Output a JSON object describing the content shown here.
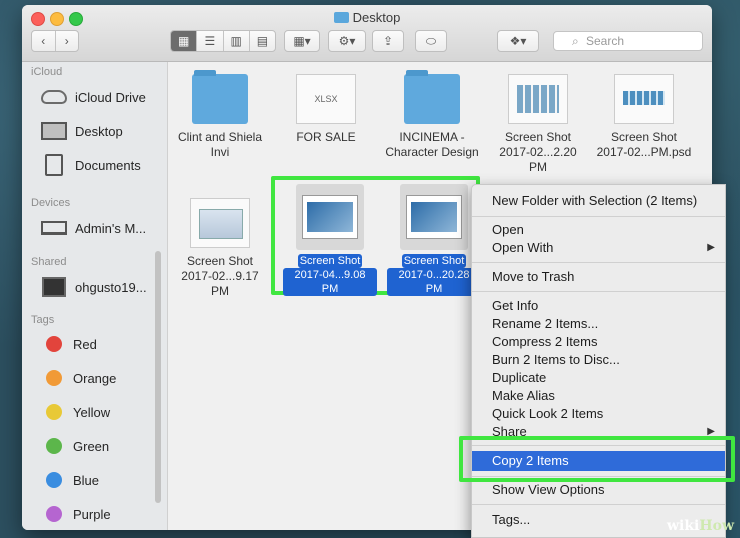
{
  "window": {
    "title": "Desktop"
  },
  "toolbar": {
    "back_icon": "chevron-left-icon",
    "forward_icon": "chevron-right-icon",
    "view_icons": [
      "icon-view-icon",
      "list-view-icon",
      "column-view-icon",
      "gallery-view-icon"
    ],
    "group_icon": "grid-icon",
    "action_icon": "gear-icon",
    "share_icon": "share-icon",
    "tag_icon": "tag-icon",
    "dropbox_icon": "dropbox-icon",
    "search_placeholder": "Search"
  },
  "sidebar": {
    "icloud_header": "iCloud",
    "icloud_items": [
      {
        "label": "iCloud Drive",
        "icon": "cloud-icon"
      },
      {
        "label": "Desktop",
        "icon": "desktop-icon"
      },
      {
        "label": "Documents",
        "icon": "document-icon"
      }
    ],
    "devices_header": "Devices",
    "devices": [
      {
        "label": "Admin's M...",
        "icon": "laptop-icon"
      }
    ],
    "shared_header": "Shared",
    "shared": [
      {
        "label": "ohgusto19...",
        "icon": "monitor-icon"
      }
    ],
    "tags_header": "Tags",
    "tags": [
      {
        "label": "Red",
        "color": "#e2443c"
      },
      {
        "label": "Orange",
        "color": "#f19a37"
      },
      {
        "label": "Yellow",
        "color": "#e8c937"
      },
      {
        "label": "Green",
        "color": "#5cb64b"
      },
      {
        "label": "Blue",
        "color": "#3a8de0"
      },
      {
        "label": "Purple",
        "color": "#b565d0"
      }
    ]
  },
  "files": [
    {
      "name_line1": "Clint and Shiela",
      "name_line2": "Invi",
      "kind": "folder"
    },
    {
      "name_line1": "FOR SALE",
      "name_line2": "",
      "kind": "xlsx",
      "badge": "XLSX"
    },
    {
      "name_line1": "INCINEMA -",
      "name_line2": "Character Design",
      "kind": "folder"
    },
    {
      "name_line1": "Screen Shot",
      "name_line2": "2017-02...2.20 PM",
      "kind": "screenshot"
    },
    {
      "name_line1": "Screen Shot",
      "name_line2": "2017-02...PM.psd",
      "kind": "screenshot"
    },
    {
      "name_line1": "Screen Shot",
      "name_line2": "2017-02...9.17 PM",
      "kind": "screenshot"
    }
  ],
  "selected_files": [
    {
      "name_line1": "Screen Shot",
      "name_line2": "2017-04...9.08 PM"
    },
    {
      "name_line1": "Screen Shot",
      "name_line2": "2017-0...20.28 PM"
    }
  ],
  "context_menu": {
    "items": [
      {
        "label": "New Folder with Selection (2 Items)"
      },
      {
        "label": "Open"
      },
      {
        "label": "Open With",
        "submenu": true
      },
      {
        "label": "Move to Trash"
      },
      {
        "label": "Get Info"
      },
      {
        "label": "Rename 2 Items..."
      },
      {
        "label": "Compress 2 Items"
      },
      {
        "label": "Burn 2 Items to Disc..."
      },
      {
        "label": "Duplicate"
      },
      {
        "label": "Make Alias"
      },
      {
        "label": "Quick Look 2 Items"
      },
      {
        "label": "Share",
        "submenu": true
      },
      {
        "label": "Copy 2 Items",
        "selected": true
      },
      {
        "label": "Show View Options"
      },
      {
        "label": "Tags..."
      }
    ]
  },
  "colors": {
    "highlight": "#40e640",
    "selection": "#2f6bd9"
  },
  "watermark": {
    "prefix": "wiki",
    "suffix": "How"
  }
}
